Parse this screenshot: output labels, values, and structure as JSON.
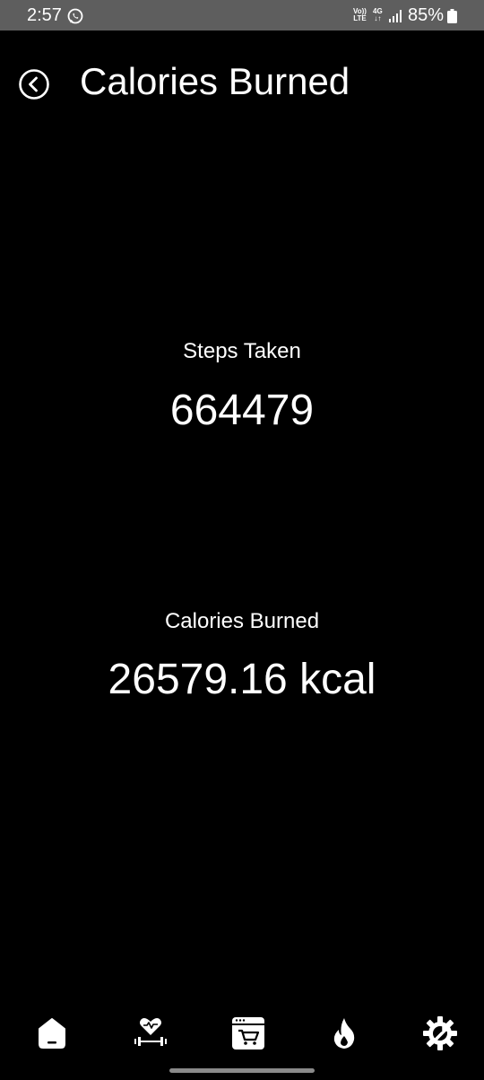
{
  "status_bar": {
    "time": "2:57",
    "volte_label_top": "Vo))",
    "volte_label_bottom": "LTE",
    "network_label": "4G",
    "network_arrows": "↓↑",
    "battery": "85%",
    "icons": [
      "whatsapp-icon",
      "signal-icon",
      "battery-icon"
    ]
  },
  "header": {
    "title": "Calories Burned",
    "back_icon": "chevron-left-circle-icon"
  },
  "stats": {
    "steps_label": "Steps Taken",
    "steps_value": "664479",
    "calories_label": "Calories Burned",
    "calories_value": "26579.16 kcal"
  },
  "bottom_nav": {
    "items": [
      {
        "icon": "home-icon"
      },
      {
        "icon": "fitness-heart-dumbbell-icon"
      },
      {
        "icon": "shop-cart-icon"
      },
      {
        "icon": "flame-icon"
      },
      {
        "icon": "settings-wrench-icon"
      }
    ]
  },
  "colors": {
    "background": "#000000",
    "status_bar": "#5e5e5e",
    "text": "#ffffff",
    "home_indicator": "#8a8a8a"
  }
}
